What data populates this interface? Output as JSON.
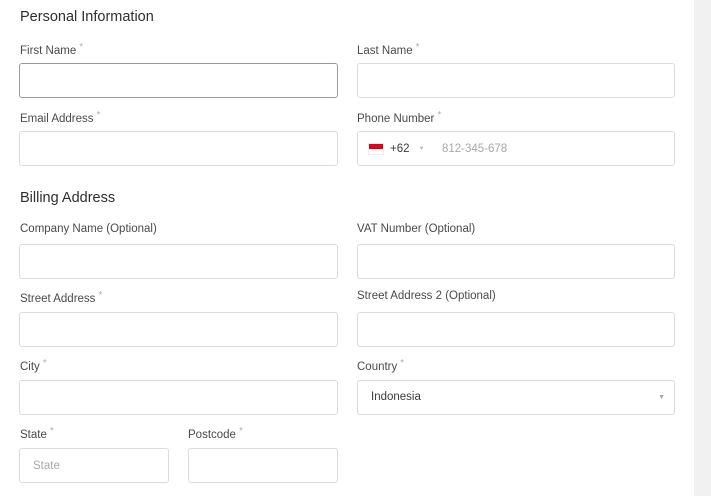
{
  "personal": {
    "title": "Personal Information",
    "first_name": {
      "label": "First Name",
      "required": "*",
      "value": "",
      "placeholder": ""
    },
    "last_name": {
      "label": "Last Name",
      "required": "*",
      "value": "",
      "placeholder": ""
    },
    "email": {
      "label": "Email Address",
      "required": "*",
      "value": "",
      "placeholder": ""
    },
    "phone": {
      "label": "Phone Number",
      "required": "*",
      "country_flag": "indonesia-flag-icon",
      "dial_code": "+62",
      "caret": "▼",
      "value": "",
      "placeholder": "812-345-678"
    }
  },
  "billing": {
    "title": "Billing Address",
    "company": {
      "label": "Company Name (Optional)",
      "value": "",
      "placeholder": ""
    },
    "vat": {
      "label": "VAT Number (Optional)",
      "value": "",
      "placeholder": ""
    },
    "street": {
      "label": "Street Address",
      "required": "*",
      "value": "",
      "placeholder": ""
    },
    "street2": {
      "label": "Street Address 2 (Optional)",
      "value": "",
      "placeholder": ""
    },
    "city": {
      "label": "City",
      "required": "*",
      "value": "",
      "placeholder": ""
    },
    "country": {
      "label": "Country",
      "required": "*",
      "selected": "Indonesia",
      "caret": "▼"
    },
    "state": {
      "label": "State",
      "required": "*",
      "value": "",
      "placeholder": "State"
    },
    "postcode": {
      "label": "Postcode",
      "required": "*",
      "value": "",
      "placeholder": ""
    }
  },
  "colors": {
    "border": "#dcdcdc",
    "focused_border": "#9a9a9a",
    "required_asterisk": "#b0b0b0",
    "flag_red": "#e0001b"
  }
}
